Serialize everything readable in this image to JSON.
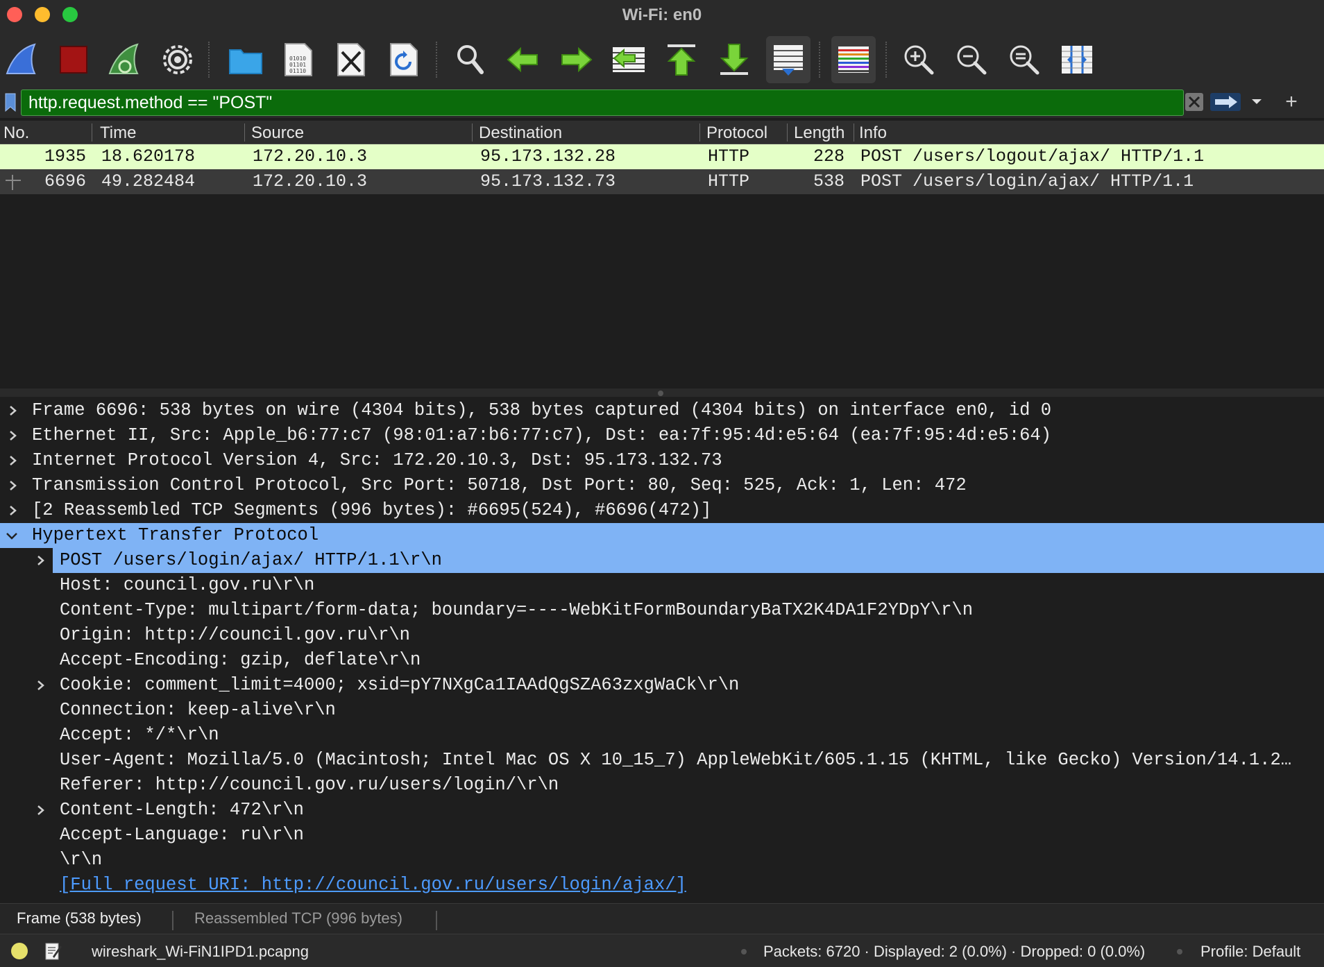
{
  "window": {
    "title": "Wi-Fi: en0"
  },
  "toolbar": {
    "buttons": [
      "start-capture",
      "stop-capture",
      "restart-capture",
      "capture-options",
      "open-file",
      "save-file",
      "close-file",
      "reload-file",
      "find-packet",
      "go-back",
      "go-forward",
      "go-to-packet",
      "first-packet",
      "last-packet",
      "auto-scroll",
      "colorize",
      "zoom-in",
      "zoom-out",
      "normal-size",
      "resize-columns"
    ]
  },
  "filter": {
    "value": "http.request.method == \"POST\""
  },
  "packet_list": {
    "columns": [
      "No.",
      "Time",
      "Source",
      "Destination",
      "Protocol",
      "Length",
      "Info"
    ],
    "rows": [
      {
        "no": "1935",
        "time": "18.620178",
        "source": "172.20.10.3",
        "destination": "95.173.132.28",
        "protocol": "HTTP",
        "length": "228",
        "info": "POST /users/logout/ajax/ HTTP/1.1"
      },
      {
        "no": "6696",
        "time": "49.282484",
        "source": "172.20.10.3",
        "destination": "95.173.132.73",
        "protocol": "HTTP",
        "length": "538",
        "info": "POST /users/login/ajax/ HTTP/1.1"
      }
    ]
  },
  "details": {
    "rows": [
      {
        "text": "Frame 6696: 538 bytes on wire (4304 bits), 538 bytes captured (4304 bits) on interface en0, id 0",
        "expander": "collapsed"
      },
      {
        "text": "Ethernet II, Src: Apple_b6:77:c7 (98:01:a7:b6:77:c7), Dst: ea:7f:95:4d:e5:64 (ea:7f:95:4d:e5:64)",
        "expander": "collapsed"
      },
      {
        "text": "Internet Protocol Version 4, Src: 172.20.10.3, Dst: 95.173.132.73",
        "expander": "collapsed"
      },
      {
        "text": "Transmission Control Protocol, Src Port: 50718, Dst Port: 80, Seq: 525, Ack: 1, Len: 472",
        "expander": "collapsed"
      },
      {
        "text": "[2 Reassembled TCP Segments (996 bytes): #6695(524), #6696(472)]",
        "expander": "collapsed"
      },
      {
        "text": "Hypertext Transfer Protocol",
        "expander": "expanded"
      },
      {
        "text": "POST /users/login/ajax/ HTTP/1.1\\r\\n",
        "expander": "collapsed"
      },
      {
        "text": "Host: council.gov.ru\\r\\n",
        "expander": "none"
      },
      {
        "text": "Content-Type: multipart/form-data; boundary=----WebKitFormBoundaryBaTX2K4DA1F2YDpY\\r\\n",
        "expander": "none"
      },
      {
        "text": "Origin: http://council.gov.ru\\r\\n",
        "expander": "none"
      },
      {
        "text": "Accept-Encoding: gzip, deflate\\r\\n",
        "expander": "none"
      },
      {
        "text": "Cookie: comment_limit=4000; xsid=pY7NXgCa1IAAdQgSZA63zxgWaCk\\r\\n",
        "expander": "collapsed"
      },
      {
        "text": "Connection: keep-alive\\r\\n",
        "expander": "none"
      },
      {
        "text": "Accept: */*\\r\\n",
        "expander": "none"
      },
      {
        "text": "User-Agent: Mozilla/5.0 (Macintosh; Intel Mac OS X 10_15_7) AppleWebKit/605.1.15 (KHTML, like Gecko) Version/14.1.2…",
        "expander": "none"
      },
      {
        "text": "Referer: http://council.gov.ru/users/login/\\r\\n",
        "expander": "none"
      },
      {
        "text": "Content-Length: 472\\r\\n",
        "expander": "collapsed"
      },
      {
        "text": "Accept-Language: ru\\r\\n",
        "expander": "none"
      },
      {
        "text": "\\r\\n",
        "expander": "none"
      },
      {
        "text": "[Full request URI: http://council.gov.ru/users/login/ajax/]",
        "expander": "none"
      }
    ]
  },
  "bytes_tabs": [
    "Frame (538 bytes)",
    "Reassembled TCP (996 bytes)"
  ],
  "status": {
    "file": "wireshark_Wi-FiN1IPD1.pcapng",
    "stats": "Packets: 6720 · Displayed: 2 (0.0%) · Dropped: 0 (0.0%)",
    "profile": "Profile: Default"
  },
  "colors": {
    "filter_valid": "#0b6b0b",
    "selected_row": "#7fb3f5",
    "http_row": "#e4ffc7",
    "link": "#4d9bff"
  }
}
